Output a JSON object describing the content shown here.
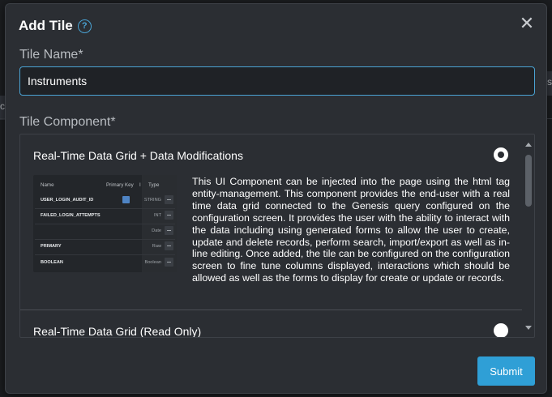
{
  "background": {
    "left_char": "c",
    "right_char": "s"
  },
  "dialog": {
    "title": "Add Tile",
    "help_icon": "question-circle-icon",
    "help_glyph": "?",
    "close_icon": "close-icon",
    "close_glyph": "✕"
  },
  "tile_name": {
    "label": "Tile Name*",
    "value": "Instruments"
  },
  "tile_component": {
    "label": "Tile Component*",
    "options": [
      {
        "label": "Real-Time Data Grid + Data Modifications",
        "selected": true,
        "description": "This UI Component can be injected into the page using the html tag entity-management. This component provides the end-user with a real time data grid connected to the Genesis query configured on the configuration screen. It provides the user with the ability to interact with the data including using generated forms to allow the user to create, update and delete records, perform search, import/export as well as in-line editing. Once added, the tile can be configured on the configuration screen to fine tune columns displayed, interactions which should be allowed as well as the forms to display for create or update or records.",
        "preview": {
          "headers": {
            "name": "Name",
            "primary_key": "Primary Key",
            "flag": "I",
            "type": "Type"
          },
          "rows": [
            {
              "name": "USER_LOGIN_AUDIT_ID",
              "checked": true,
              "type": "STRING"
            },
            {
              "name": "FAILED_LOGIN_ATTEMPTS",
              "checked": false,
              "type": "INT"
            },
            {
              "name": "",
              "checked": false,
              "type": "Date"
            },
            {
              "name": "PRIMARY",
              "checked": false,
              "type": "Raw"
            },
            {
              "name": "BOOLEAN",
              "checked": false,
              "type": "Boolean"
            }
          ]
        }
      },
      {
        "label": "Real-Time Data Grid (Read Only)",
        "selected": false
      }
    ]
  },
  "actions": {
    "submit_label": "Submit"
  },
  "colors": {
    "accent": "#2f9fd6",
    "dialog_bg": "#2b2e33",
    "page_bg": "#1b1d20"
  }
}
